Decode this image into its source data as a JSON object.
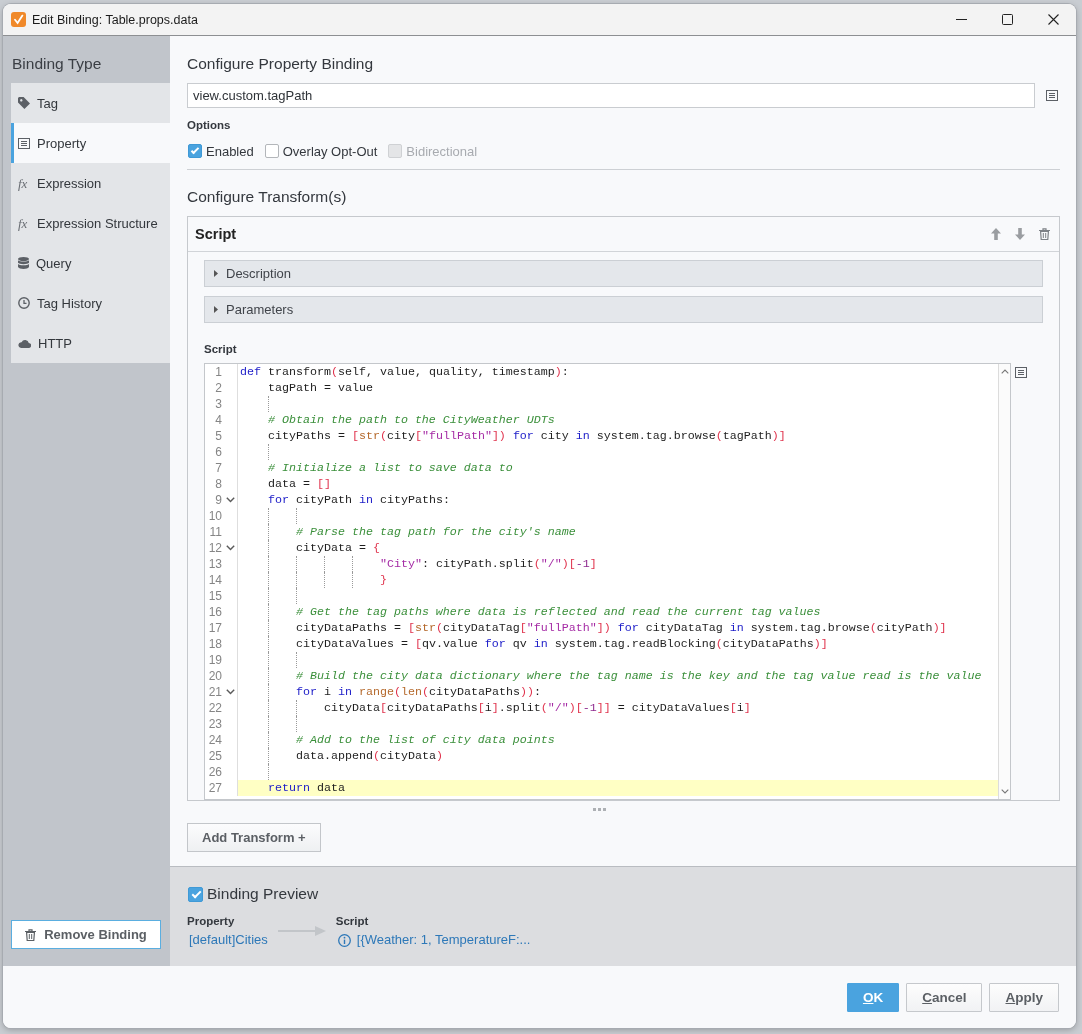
{
  "window": {
    "title": "Edit Binding: Table.props.data"
  },
  "sidebar": {
    "title": "Binding Type",
    "items": [
      {
        "label": "Tag",
        "selected": false
      },
      {
        "label": "Property",
        "selected": true
      },
      {
        "label": "Expression",
        "glyph": "fx",
        "selected": false
      },
      {
        "label": "Expression Structure",
        "glyph": "fx",
        "selected": false
      },
      {
        "label": "Query",
        "selected": false
      },
      {
        "label": "Tag History",
        "selected": false
      },
      {
        "label": "HTTP",
        "selected": false
      }
    ],
    "remove_button": "Remove Binding"
  },
  "property_binding": {
    "heading": "Configure Property Binding",
    "path": "view.custom.tagPath",
    "options_label": "Options",
    "options": [
      {
        "label": "Enabled",
        "checked": true,
        "disabled": false
      },
      {
        "label": "Overlay Opt-Out",
        "checked": false,
        "disabled": false
      },
      {
        "label": "Bidirectional",
        "checked": false,
        "disabled": true
      }
    ]
  },
  "transforms": {
    "heading": "Configure Transform(s)",
    "items": [
      {
        "title": "Script",
        "sections": [
          {
            "label": "Description",
            "expanded": false
          },
          {
            "label": "Parameters",
            "expanded": false
          }
        ],
        "script_label": "Script",
        "code": [
          {
            "number": "1",
            "foldable": false,
            "current": false,
            "tokens": [
              {
                "kind": "keyword",
                "text": "def"
              },
              {
                "kind": "plain",
                "text": " transform"
              },
              {
                "kind": "bracket",
                "text": "("
              },
              {
                "kind": "plain",
                "text": "self, value, quality, timestamp"
              },
              {
                "kind": "bracket",
                "text": ")"
              },
              {
                "kind": "plain",
                "text": ":"
              }
            ]
          },
          {
            "number": "2",
            "foldable": false,
            "current": false,
            "tokens": [
              {
                "kind": "plain",
                "text": "    tagPath = value"
              }
            ]
          },
          {
            "number": "3",
            "foldable": false,
            "current": false
          },
          {
            "number": "4",
            "foldable": false,
            "current": false,
            "tokens": [
              {
                "kind": "comment",
                "text": "    # Obtain the path to the CityWeather UDTs"
              }
            ]
          },
          {
            "number": "5",
            "foldable": false,
            "current": false,
            "tokens": [
              {
                "kind": "plain",
                "text": "    cityPaths = "
              },
              {
                "kind": "bracket",
                "text": "["
              },
              {
                "kind": "builtin",
                "text": "str"
              },
              {
                "kind": "bracket",
                "text": "("
              },
              {
                "kind": "plain",
                "text": "city"
              },
              {
                "kind": "bracket",
                "text": "["
              },
              {
                "kind": "string",
                "text": "\"fullPath\""
              },
              {
                "kind": "bracket",
                "text": "]) "
              },
              {
                "kind": "keyword",
                "text": "for"
              },
              {
                "kind": "plain",
                "text": " city "
              },
              {
                "kind": "keyword",
                "text": "in"
              },
              {
                "kind": "plain",
                "text": " system.tag.browse"
              },
              {
                "kind": "bracket",
                "text": "("
              },
              {
                "kind": "plain",
                "text": "tagPath"
              },
              {
                "kind": "bracket",
                "text": ")]"
              }
            ]
          },
          {
            "number": "6",
            "foldable": false,
            "current": false
          },
          {
            "number": "7",
            "foldable": false,
            "current": false,
            "tokens": [
              {
                "kind": "comment",
                "text": "    # Initialize a list to save data to"
              }
            ]
          },
          {
            "number": "8",
            "foldable": false,
            "current": false,
            "tokens": [
              {
                "kind": "plain",
                "text": "    data = "
              },
              {
                "kind": "bracket",
                "text": "[]"
              }
            ]
          },
          {
            "number": "9",
            "foldable": true,
            "current": false,
            "tokens": [
              {
                "kind": "keyword",
                "text": "    for"
              },
              {
                "kind": "plain",
                "text": " cityPath "
              },
              {
                "kind": "keyword",
                "text": "in"
              },
              {
                "kind": "plain",
                "text": " cityPaths:"
              }
            ]
          },
          {
            "number": "10",
            "foldable": false,
            "current": false
          },
          {
            "number": "11",
            "foldable": false,
            "current": false,
            "tokens": [
              {
                "kind": "comment",
                "text": "        # Parse the tag path for the city's name"
              }
            ]
          },
          {
            "number": "12",
            "foldable": true,
            "current": false,
            "tokens": [
              {
                "kind": "plain",
                "text": "        cityData = "
              },
              {
                "kind": "bracket",
                "text": "{"
              }
            ]
          },
          {
            "number": "13",
            "foldable": false,
            "current": false,
            "tokens": [
              {
                "kind": "string",
                "text": "                    \"City\""
              },
              {
                "kind": "plain",
                "text": ": cityPath.split"
              },
              {
                "kind": "bracket",
                "text": "("
              },
              {
                "kind": "string",
                "text": "\"/\""
              },
              {
                "kind": "bracket",
                "text": ")["
              },
              {
                "kind": "number",
                "text": "-1"
              },
              {
                "kind": "bracket",
                "text": "]"
              }
            ]
          },
          {
            "number": "14",
            "foldable": false,
            "current": false,
            "tokens": [
              {
                "kind": "bracket",
                "text": "                    }"
              }
            ]
          },
          {
            "number": "15",
            "foldable": false,
            "current": false
          },
          {
            "number": "16",
            "foldable": false,
            "current": false,
            "tokens": [
              {
                "kind": "comment",
                "text": "        # Get the tag paths where data is reflected and read the current tag values"
              }
            ]
          },
          {
            "number": "17",
            "foldable": false,
            "current": false,
            "tokens": [
              {
                "kind": "plain",
                "text": "        cityDataPaths = "
              },
              {
                "kind": "bracket",
                "text": "["
              },
              {
                "kind": "builtin",
                "text": "str"
              },
              {
                "kind": "bracket",
                "text": "("
              },
              {
                "kind": "plain",
                "text": "cityDataTag"
              },
              {
                "kind": "bracket",
                "text": "["
              },
              {
                "kind": "string",
                "text": "\"fullPath\""
              },
              {
                "kind": "bracket",
                "text": "]) "
              },
              {
                "kind": "keyword",
                "text": "for"
              },
              {
                "kind": "plain",
                "text": " cityDataTag "
              },
              {
                "kind": "keyword",
                "text": "in"
              },
              {
                "kind": "plain",
                "text": " system.tag.browse"
              },
              {
                "kind": "bracket",
                "text": "("
              },
              {
                "kind": "plain",
                "text": "cityPath"
              },
              {
                "kind": "bracket",
                "text": ")]"
              }
            ]
          },
          {
            "number": "18",
            "foldable": false,
            "current": false,
            "tokens": [
              {
                "kind": "plain",
                "text": "        cityDataValues = "
              },
              {
                "kind": "bracket",
                "text": "["
              },
              {
                "kind": "plain",
                "text": "qv.value "
              },
              {
                "kind": "keyword",
                "text": "for"
              },
              {
                "kind": "plain",
                "text": " qv "
              },
              {
                "kind": "keyword",
                "text": "in"
              },
              {
                "kind": "plain",
                "text": " system.tag.readBlocking"
              },
              {
                "kind": "bracket",
                "text": "("
              },
              {
                "kind": "plain",
                "text": "cityDataPaths"
              },
              {
                "kind": "bracket",
                "text": ")]"
              }
            ]
          },
          {
            "number": "19",
            "foldable": false,
            "current": false
          },
          {
            "number": "20",
            "foldable": false,
            "current": false,
            "tokens": [
              {
                "kind": "comment",
                "text": "        # Build the city data dictionary where the tag name is the key and the tag value read is the value"
              }
            ]
          },
          {
            "number": "21",
            "foldable": true,
            "current": false,
            "tokens": [
              {
                "kind": "keyword",
                "text": "        for"
              },
              {
                "kind": "plain",
                "text": " i "
              },
              {
                "kind": "keyword",
                "text": "in"
              },
              {
                "kind": "builtin",
                "text": " range"
              },
              {
                "kind": "bracket",
                "text": "("
              },
              {
                "kind": "builtin",
                "text": "len"
              },
              {
                "kind": "bracket",
                "text": "("
              },
              {
                "kind": "plain",
                "text": "cityDataPaths"
              },
              {
                "kind": "bracket",
                "text": "))"
              },
              {
                "kind": "plain",
                "text": ":"
              }
            ]
          },
          {
            "number": "22",
            "foldable": false,
            "current": false,
            "tokens": [
              {
                "kind": "plain",
                "text": "            cityData"
              },
              {
                "kind": "bracket",
                "text": "["
              },
              {
                "kind": "plain",
                "text": "cityDataPaths"
              },
              {
                "kind": "bracket",
                "text": "["
              },
              {
                "kind": "plain",
                "text": "i"
              },
              {
                "kind": "bracket",
                "text": "]"
              },
              {
                "kind": "plain",
                "text": ".split"
              },
              {
                "kind": "bracket",
                "text": "("
              },
              {
                "kind": "string",
                "text": "\"/\""
              },
              {
                "kind": "bracket",
                "text": ")["
              },
              {
                "kind": "number",
                "text": "-1"
              },
              {
                "kind": "bracket",
                "text": "]]"
              },
              {
                "kind": "plain",
                "text": " = cityDataValues"
              },
              {
                "kind": "bracket",
                "text": "["
              },
              {
                "kind": "plain",
                "text": "i"
              },
              {
                "kind": "bracket",
                "text": "]"
              }
            ]
          },
          {
            "number": "23",
            "foldable": false,
            "current": false
          },
          {
            "number": "24",
            "foldable": false,
            "current": false,
            "tokens": [
              {
                "kind": "comment",
                "text": "        # Add to the list of city data points"
              }
            ]
          },
          {
            "number": "25",
            "foldable": false,
            "current": false,
            "tokens": [
              {
                "kind": "plain",
                "text": "        data.append"
              },
              {
                "kind": "bracket",
                "text": "("
              },
              {
                "kind": "plain",
                "text": "cityData"
              },
              {
                "kind": "bracket",
                "text": ")"
              }
            ]
          },
          {
            "number": "26",
            "foldable": false,
            "current": false
          },
          {
            "number": "27",
            "foldable": false,
            "current": true,
            "tokens": [
              {
                "kind": "keyword",
                "text": "    return"
              },
              {
                "kind": "plain",
                "text": " data"
              }
            ]
          }
        ]
      }
    ],
    "add_button": "Add Transform +"
  },
  "preview": {
    "title": "Binding Preview",
    "checked": true,
    "source": {
      "label": "Property",
      "value": "[default]Cities"
    },
    "result": {
      "label": "Script",
      "value": "[{Weather: 1, TemperatureF:..."
    }
  },
  "buttons": [
    {
      "label": "OK",
      "kind": "primary",
      "mnemonic": true
    },
    {
      "label": "Cancel",
      "kind": "secondary",
      "mnemonic": true
    },
    {
      "label": "Apply",
      "kind": "secondary",
      "mnemonic": true
    }
  ]
}
